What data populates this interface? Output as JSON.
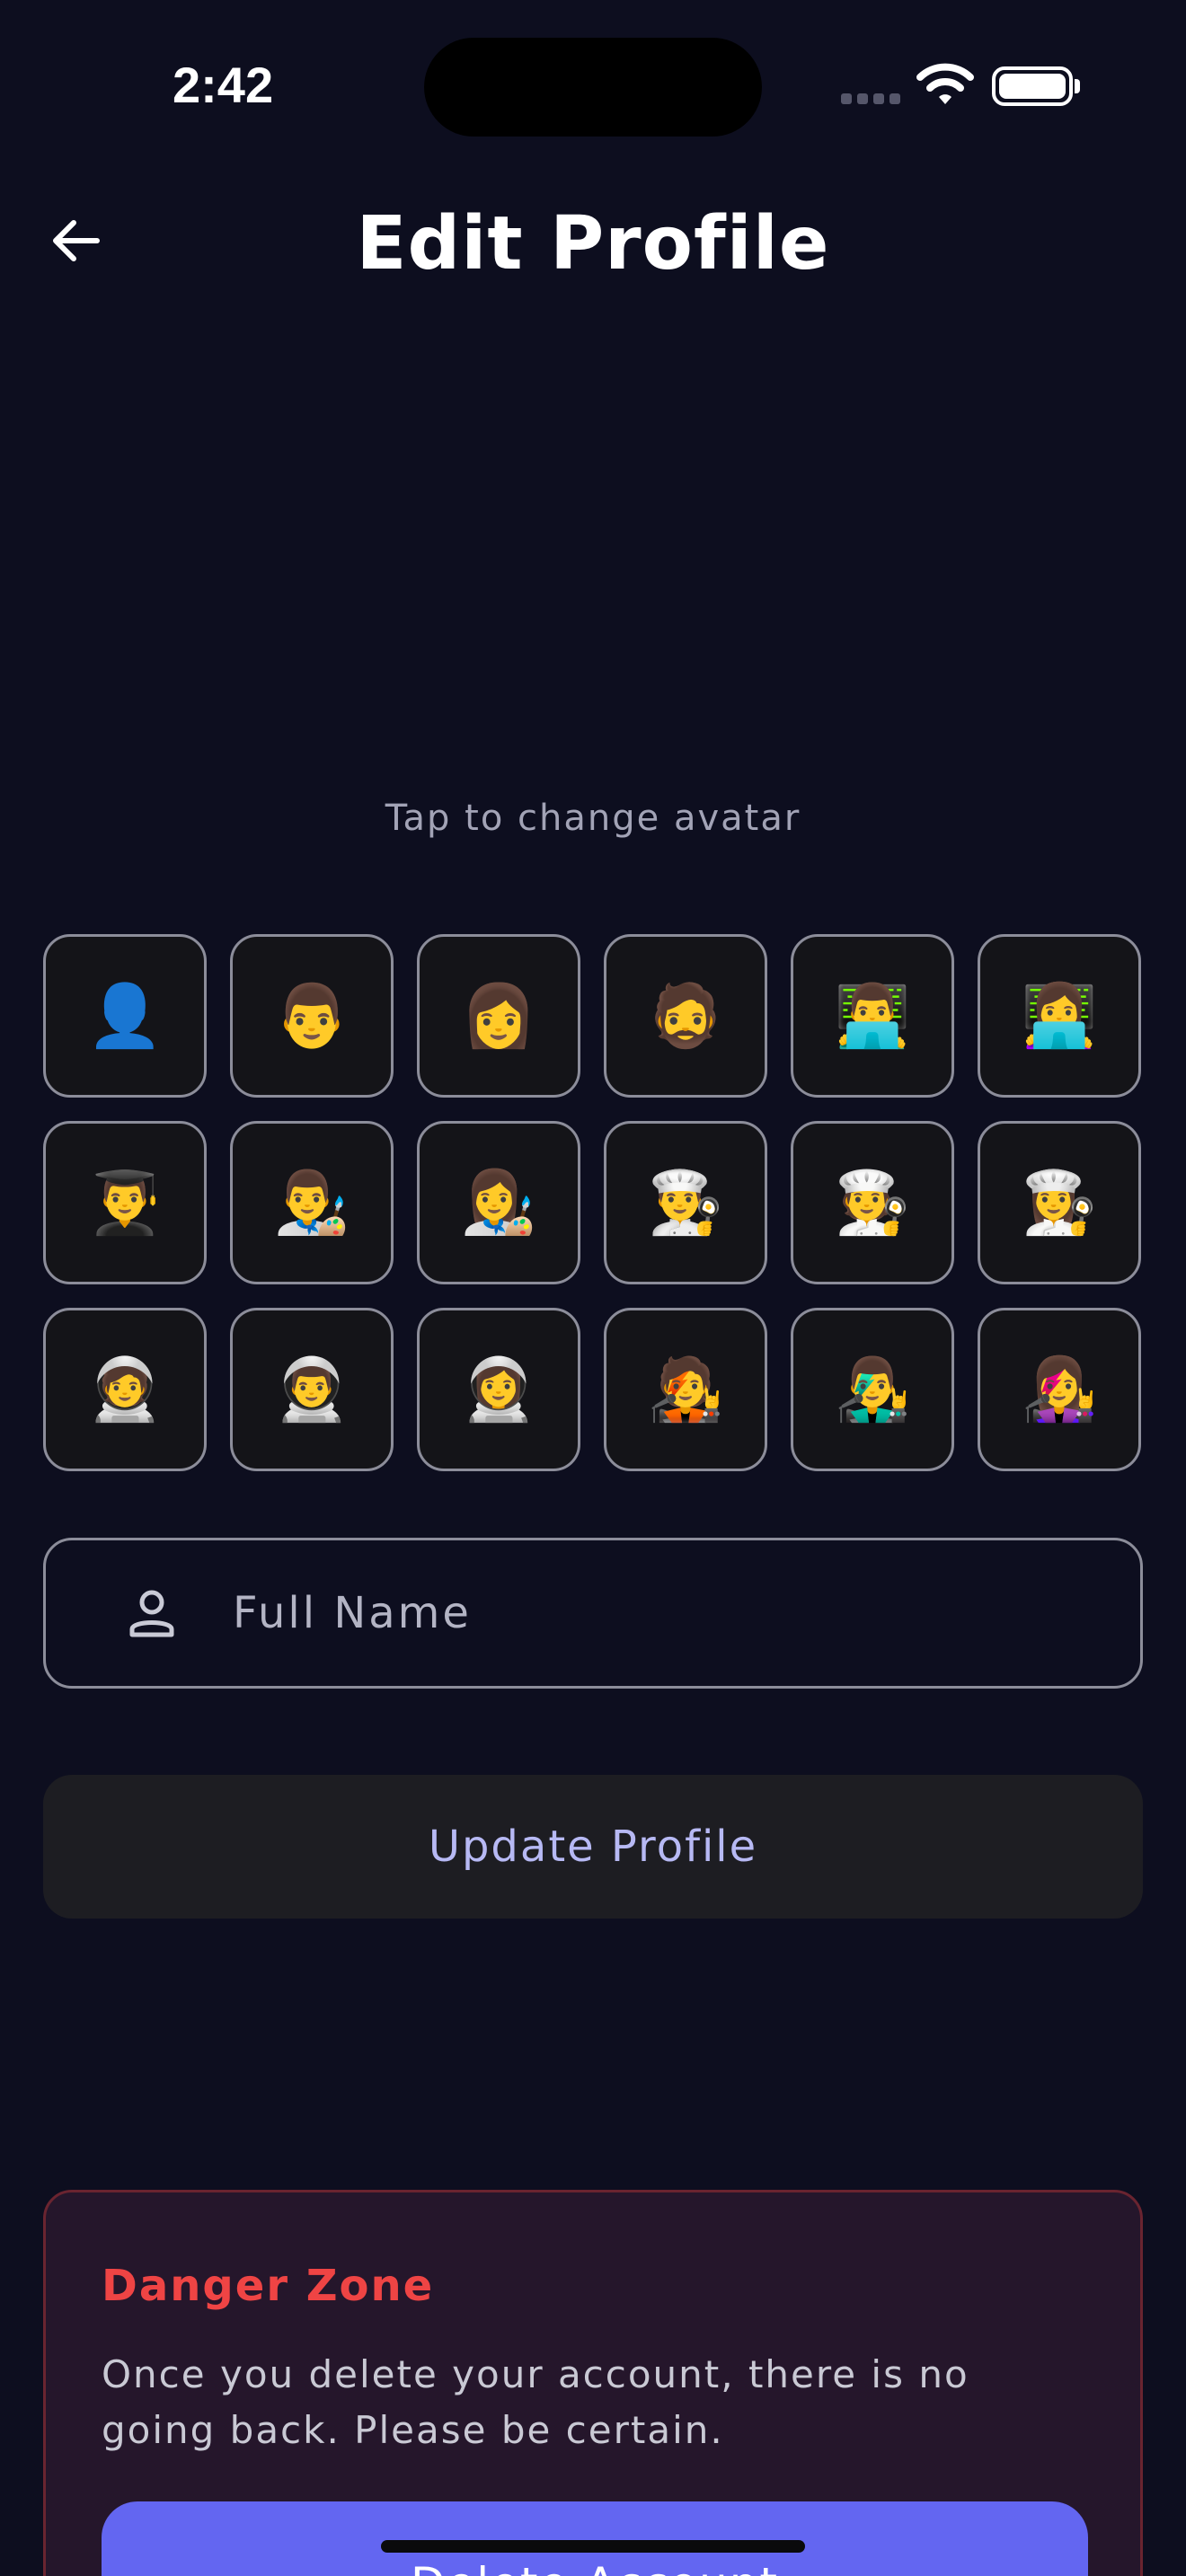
{
  "status_bar": {
    "time": "2:42"
  },
  "header": {
    "title": "Edit Profile"
  },
  "avatar": {
    "hint": "Tap to change avatar",
    "options": [
      "👤",
      "👨",
      "👩",
      "🧔",
      "👨‍💻",
      "👩‍💻",
      "👨‍🎓",
      "👨‍🎨",
      "👩‍🎨",
      "👨‍🍳",
      "🧑‍🍳",
      "👩‍🍳",
      "🧑‍🚀",
      "👨‍🚀",
      "👩‍🚀",
      "🧑‍🎤",
      "👨‍🎤",
      "👩‍🎤"
    ]
  },
  "form": {
    "name_placeholder": "Full Name",
    "name_value": "",
    "update_label": "Update Profile"
  },
  "danger_zone": {
    "title": "Danger Zone",
    "description": "Once you delete your account, there is no going back. Please be certain.",
    "delete_label": "Delete Account"
  },
  "colors": {
    "background": "#0d0e1f",
    "accent": "#6366f1",
    "danger": "#ef4444",
    "button_text": "#b7b9f4"
  }
}
